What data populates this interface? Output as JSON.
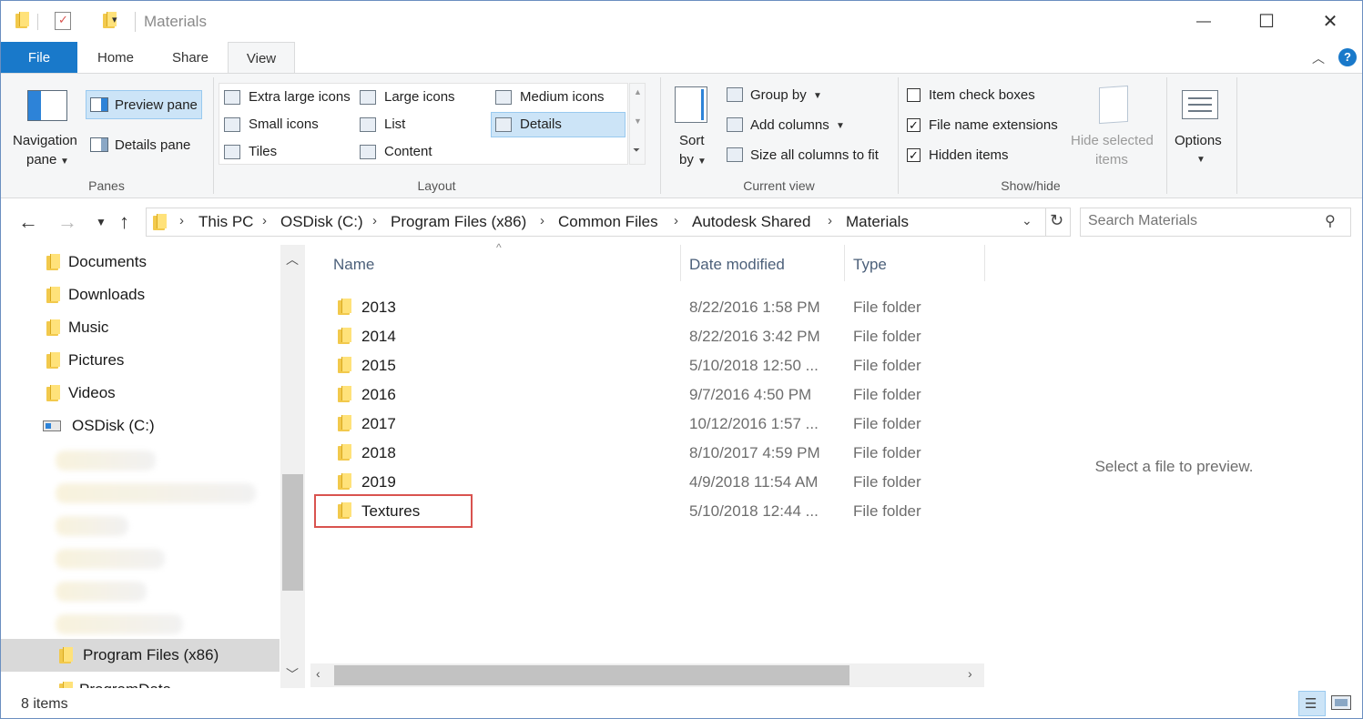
{
  "window": {
    "title": "Materials",
    "minimize_glyph": "—",
    "maximize_glyph": "☐",
    "close_glyph": "✕"
  },
  "ribbon_tabs": [
    "File",
    "Home",
    "Share",
    "View"
  ],
  "ribbon": {
    "panes": {
      "navigation_pane": "Navigation",
      "navigation_pane_2": "pane",
      "preview_pane": "Preview pane",
      "details_pane": "Details pane",
      "group_label": "Panes"
    },
    "layout": {
      "items": [
        "Extra large icons",
        "Large icons",
        "Medium icons",
        "Small icons",
        "List",
        "Details",
        "Tiles",
        "Content"
      ],
      "group_label": "Layout"
    },
    "current_view": {
      "sort_by": "Sort",
      "sort_by_2": "by",
      "group_by": "Group by",
      "add_columns": "Add columns",
      "size_all_columns": "Size all columns to fit",
      "group_label": "Current view"
    },
    "show_hide": {
      "item_check_boxes": "Item check boxes",
      "file_name_extensions": "File name extensions",
      "hidden_items": "Hidden items",
      "hide_selected": "Hide selected",
      "hide_selected_2": "items",
      "group_label": "Show/hide"
    },
    "options": "Options"
  },
  "breadcrumb": [
    "This PC",
    "OSDisk (C:)",
    "Program Files (x86)",
    "Common Files",
    "Autodesk Shared",
    "Materials"
  ],
  "search": {
    "placeholder": "Search Materials"
  },
  "nav_pane": {
    "items": [
      "Documents",
      "Downloads",
      "Music",
      "Pictures",
      "Videos",
      "OSDisk (C:)"
    ],
    "selected": "Program Files (x86)",
    "partial": "ProgramData"
  },
  "file_list": {
    "columns": [
      "Name",
      "Date modified",
      "Type"
    ],
    "rows": [
      {
        "name": "2013",
        "date": "8/22/2016 1:58 PM",
        "type": "File folder"
      },
      {
        "name": "2014",
        "date": "8/22/2016 3:42 PM",
        "type": "File folder"
      },
      {
        "name": "2015",
        "date": "5/10/2018 12:50 ...",
        "type": "File folder"
      },
      {
        "name": "2016",
        "date": "9/7/2016 4:50 PM",
        "type": "File folder"
      },
      {
        "name": "2017",
        "date": "10/12/2016 1:57 ...",
        "type": "File folder"
      },
      {
        "name": "2018",
        "date": "8/10/2017 4:59 PM",
        "type": "File folder"
      },
      {
        "name": "2019",
        "date": "4/9/2018 11:54 AM",
        "type": "File folder"
      },
      {
        "name": "Textures",
        "date": "5/10/2018 12:44 ...",
        "type": "File folder"
      }
    ]
  },
  "preview": {
    "message": "Select a file to preview."
  },
  "status": {
    "item_count": "8 items"
  },
  "colors": {
    "accent": "#1979ca",
    "highlight_box": "#d9534f",
    "selected_ribbon": "#cce4f7"
  }
}
